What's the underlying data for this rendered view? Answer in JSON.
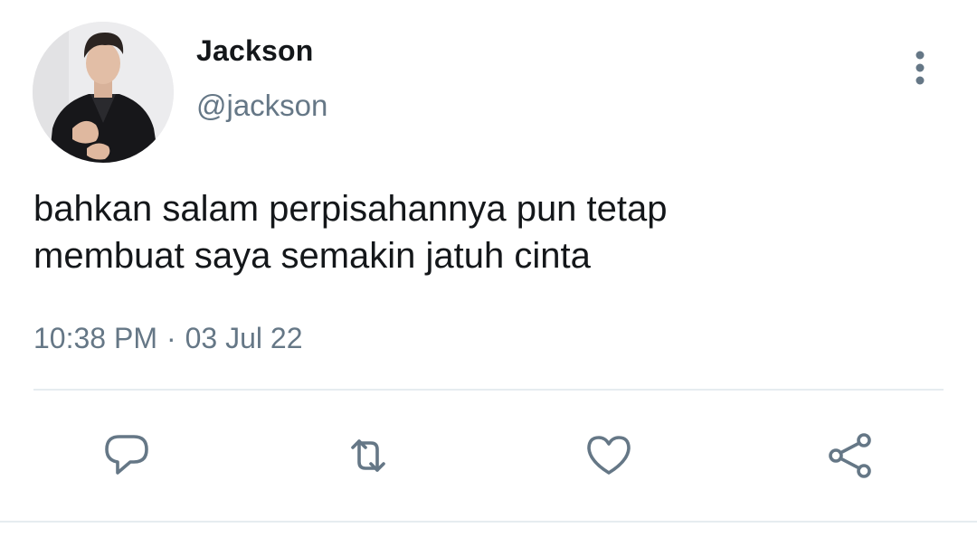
{
  "user": {
    "display_name": "Jackson",
    "handle": "@jackson",
    "avatar": "profile-photo"
  },
  "tweet": {
    "text_lines": [
      "bahkan salam perpisahannya pun tetap",
      "membuat saya semakin jatuh cinta"
    ],
    "time": "10:38 PM",
    "separator": "·",
    "date": "03 Jul 22"
  },
  "icons": {
    "more": "more-vertical-icon",
    "reply": "reply-icon",
    "retweet": "retweet-icon",
    "like": "heart-icon",
    "share": "share-icon"
  },
  "colors": {
    "text": "#14171a",
    "secondary": "#657786",
    "divider": "#e6ecf0",
    "background": "#ffffff"
  }
}
